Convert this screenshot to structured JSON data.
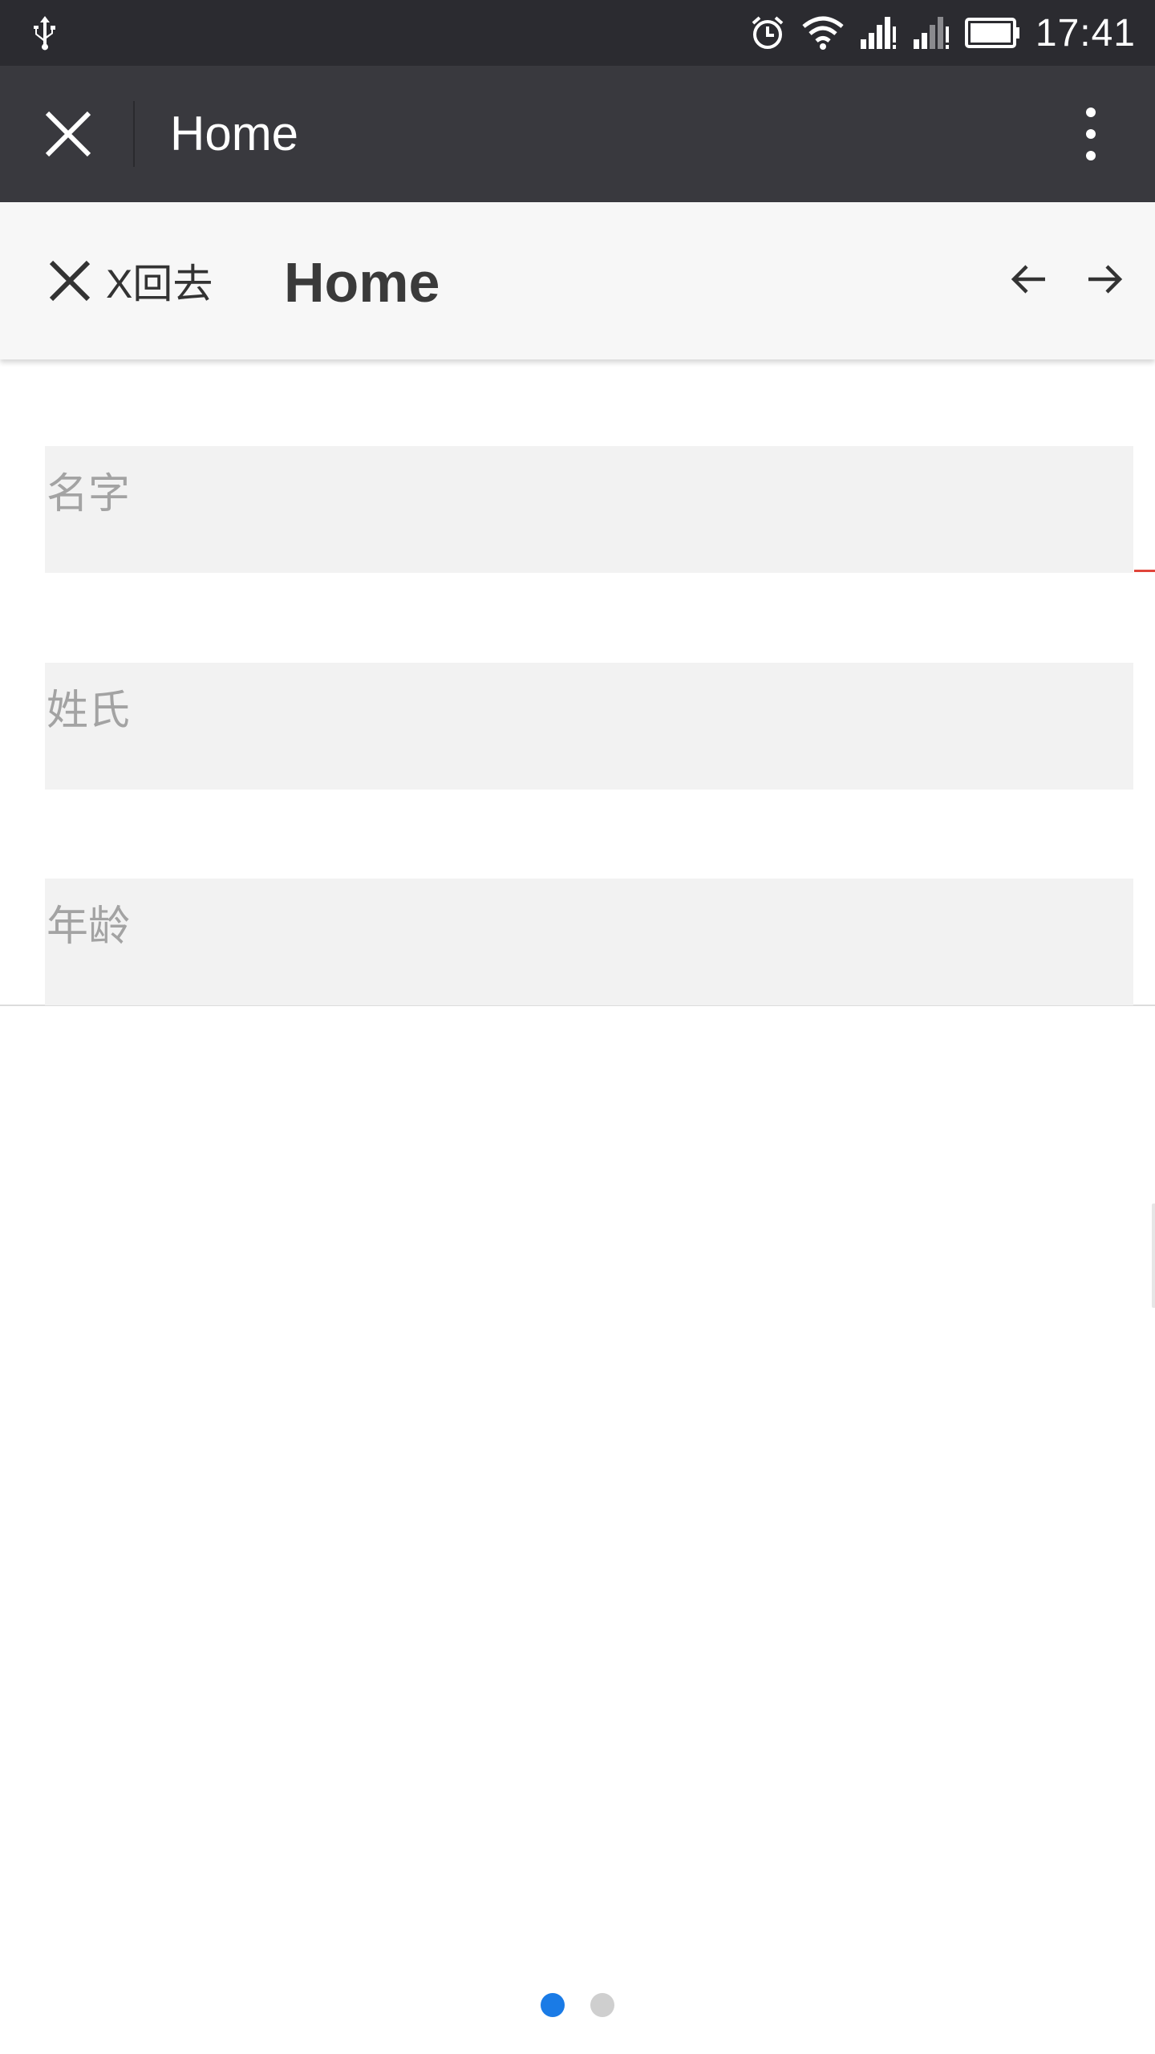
{
  "status_bar": {
    "time": "17:41",
    "icons": [
      "usb-icon",
      "alarm-icon",
      "wifi-icon",
      "signal-sim1-icon",
      "signal-sim2-icon",
      "battery-icon"
    ]
  },
  "app_bar": {
    "title": "Home",
    "close_icon": "close-icon",
    "more_icon": "more-vertical-icon"
  },
  "nav_bar": {
    "back_label": "X回去",
    "title": "Home",
    "back_icon": "close-icon",
    "prev_icon": "arrow-left-icon",
    "next_icon": "arrow-right-icon"
  },
  "form": {
    "first_name": {
      "placeholder": "名字",
      "value": ""
    },
    "last_name": {
      "placeholder": "姓氏",
      "value": ""
    },
    "age": {
      "placeholder": "年龄",
      "value": ""
    }
  },
  "pager": {
    "total": 2,
    "active_index": 0,
    "active_color": "#1a7be6",
    "inactive_color": "#cfcfcf"
  },
  "colors": {
    "status_bar_bg": "#2b2b30",
    "app_bar_bg": "#39393e",
    "nav_bar_bg": "#f7f7f7",
    "field_bg": "#f2f2f2",
    "placeholder": "#a3a3a3",
    "accent_red": "#e0453b"
  }
}
